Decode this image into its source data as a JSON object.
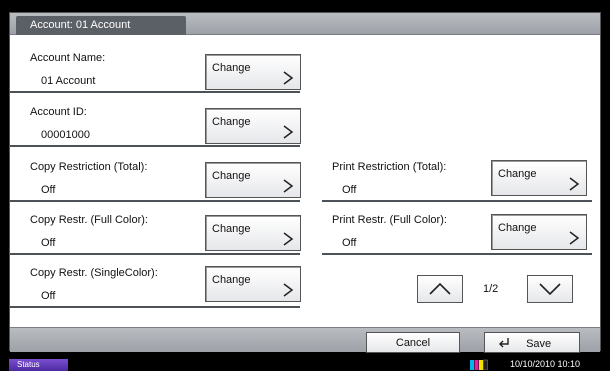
{
  "panel": {
    "title": "Account:  01 Account"
  },
  "fields": {
    "account_name": {
      "label": "Account Name:",
      "value": "01 Account"
    },
    "account_id": {
      "label": "Account ID:",
      "value": "00001000"
    },
    "copy_total": {
      "label": "Copy Restriction (Total):",
      "value": "Off"
    },
    "copy_full_color": {
      "label": "Copy Restr. (Full Color):",
      "value": "Off"
    },
    "copy_single_color": {
      "label": "Copy Restr. (SingleColor):",
      "value": "Off"
    },
    "print_total": {
      "label": "Print Restriction (Total):",
      "value": "Off"
    },
    "print_full_color": {
      "label": "Print Restr. (Full Color):",
      "value": "Off"
    }
  },
  "buttons": {
    "change_label": "Change"
  },
  "pagination": {
    "text": "1/2"
  },
  "footer": {
    "cancel": "Cancel",
    "save": "Save"
  },
  "status": {
    "label": "Status",
    "datetime": "10/10/2010  10:10"
  }
}
